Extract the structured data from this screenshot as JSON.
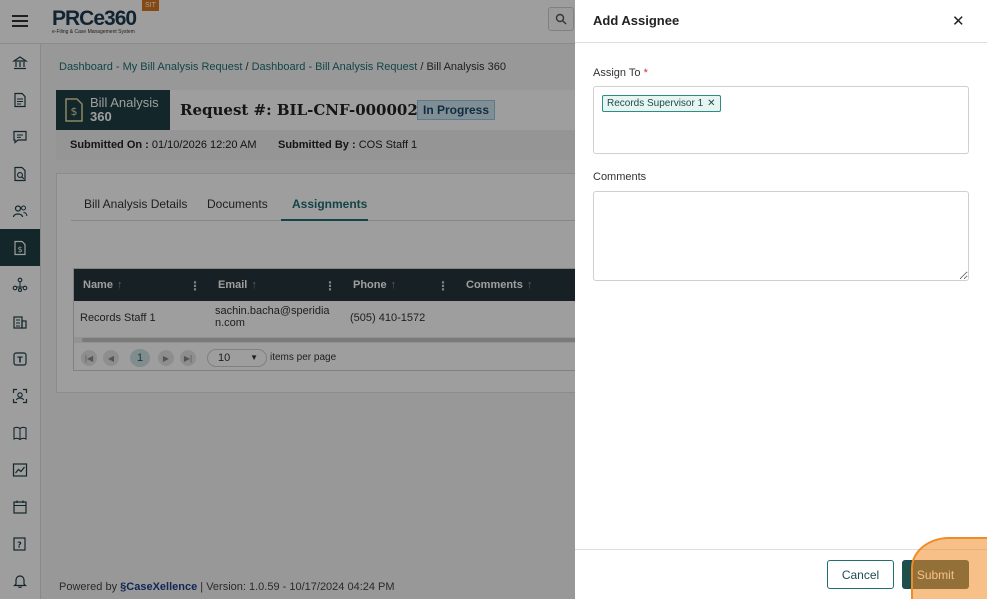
{
  "app": {
    "logo_text": "PRCe360",
    "logo_subtitle": "e-Filing & Case Management System",
    "env_badge": "SIT"
  },
  "sidebar": {
    "items": [
      {
        "icon": "bank-icon"
      },
      {
        "icon": "document-icon"
      },
      {
        "icon": "chat-icon"
      },
      {
        "icon": "document-search-icon"
      },
      {
        "icon": "users-icon"
      },
      {
        "icon": "bill-dollar-icon",
        "active": true
      },
      {
        "icon": "network-icon"
      },
      {
        "icon": "building-icon"
      },
      {
        "icon": "template-icon"
      },
      {
        "icon": "scan-user-icon"
      },
      {
        "icon": "book-icon"
      },
      {
        "icon": "chart-icon"
      },
      {
        "icon": "calendar-icon"
      },
      {
        "icon": "help-book-icon"
      },
      {
        "icon": "bell-icon"
      }
    ]
  },
  "breadcrumb": {
    "item1": "Dashboard - My Bill Analysis Request",
    "sep": " / ",
    "item2": "Dashboard - Bill Analysis Request",
    "current": "Bill Analysis 360"
  },
  "request": {
    "block_line1": "Bill Analysis",
    "block_line2": "360",
    "title": "Request #: BIL-CNF-0000022-26",
    "status": "In Progress",
    "submitted_on_label": "Submitted On :",
    "submitted_on_value": "01/10/2026 12:20 AM",
    "submitted_by_label": "Submitted By :",
    "submitted_by_value": "COS Staff 1"
  },
  "tabs": [
    {
      "label": "Bill Analysis Details"
    },
    {
      "label": "Documents"
    },
    {
      "label": "Assignments",
      "active": true
    }
  ],
  "grid": {
    "columns": [
      "Name",
      "Email",
      "Phone",
      "Comments"
    ],
    "rows": [
      {
        "name": "Records Staff 1",
        "email_line1": "sachin.bacha@speridia",
        "email_line2": "n.com",
        "phone": "(505) 410-1572",
        "comments": ""
      }
    ],
    "pager": {
      "current_page": "1",
      "page_size": "10",
      "items_label": "items per page"
    }
  },
  "footer": {
    "powered_by": "Powered by",
    "brand": "CaseXellence",
    "version": "|  Version: 1.0.59 - 10/17/2024 04:24 PM"
  },
  "panel": {
    "title": "Add Assignee",
    "assign_to_label": "Assign To",
    "required_mark": "*",
    "selected_assignee": "Records Supervisor 1",
    "comments_label": "Comments",
    "comments_value": "",
    "cancel_label": "Cancel",
    "submit_label": "Submit"
  },
  "colors": {
    "primary_dark": "#1f3e45",
    "accent_teal": "#1f6f73",
    "status_badge_bg": "#cfe6f2",
    "env_badge": "#d9771f",
    "click_highlight": "#f08c28"
  }
}
